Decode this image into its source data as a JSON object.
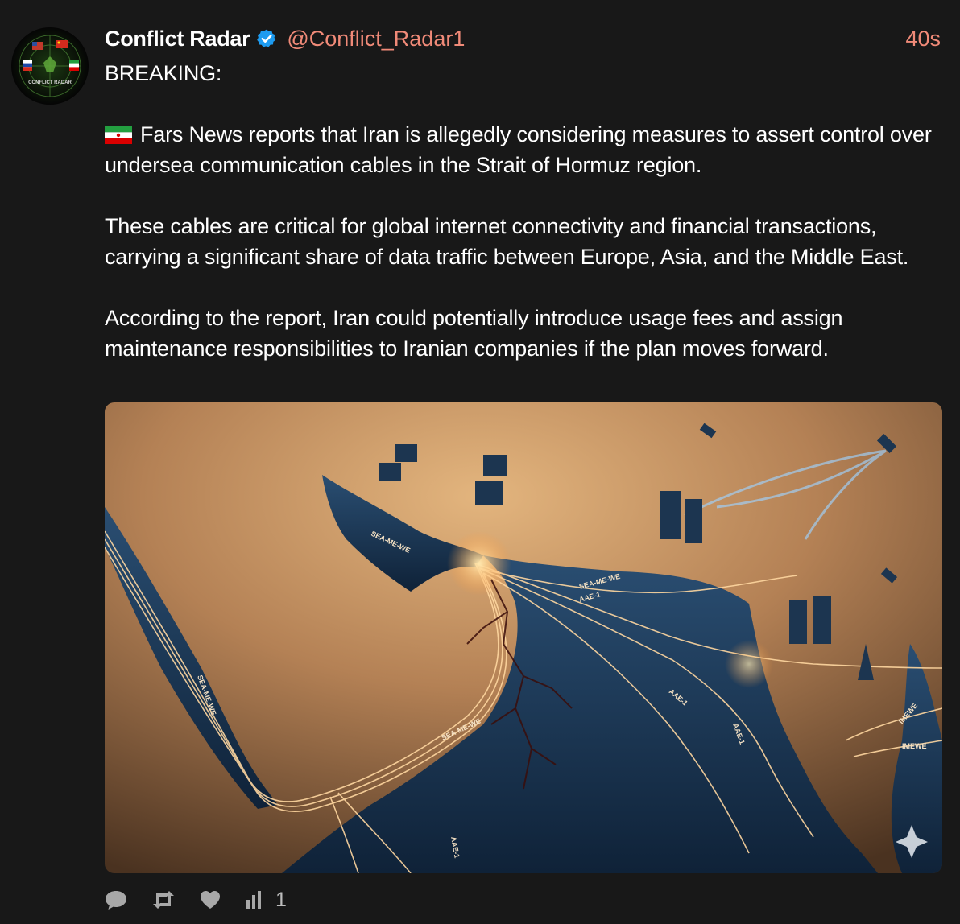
{
  "post": {
    "author_name": "Conflict Radar",
    "handle": "@Conflict_Radar1",
    "time": "40s",
    "avatar_text": "CONFLICT RADAR",
    "headline": "BREAKING:",
    "paragraphs": [
      "Fars News reports that Iran is allegedly considering measures to assert control over undersea communication cables in the Strait of Hormuz region.",
      "These cables are critical for global internet connectivity and financial transactions, carrying a significant share of data traffic between Europe, Asia, and the Middle East.",
      "According to the report, Iran could potentially introduce usage fees and assign maintenance responsibilities to Iranian companies if the plan moves forward."
    ],
    "media": {
      "cable_labels": [
        "SEA-ME-WE",
        "SEA-ME-WE",
        "AAE-1",
        "SEA-ME-WE",
        "AAE-1",
        "SEA-ME-WE",
        "AAE-1",
        "IMEWE",
        "IMEWE",
        "AAE-1"
      ]
    },
    "views_count": "1"
  },
  "colors": {
    "background": "#181818",
    "accent": "#f08a78",
    "verified": "#1d9bf0",
    "icon": "#a8a8a8"
  },
  "icons": [
    "verified-icon",
    "reply-icon",
    "repost-icon",
    "like-icon",
    "views-icon"
  ]
}
